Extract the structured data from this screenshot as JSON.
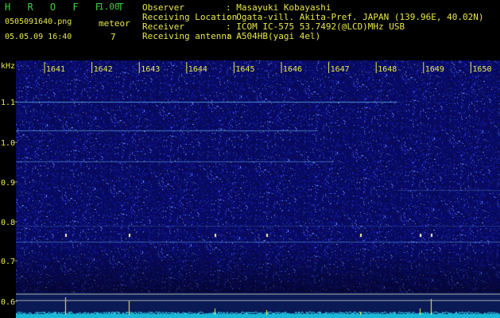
{
  "header": {
    "app_name": "H R O F F T",
    "version": "1.00",
    "filename": "0505091640.png",
    "meteor_label": "meteor",
    "datetime": "05.05.09 16:40",
    "meteor_count": "7",
    "info": [
      {
        "label": "Observer",
        "value": ": Masayuki Kobayashi"
      },
      {
        "label": "Receiving Location",
        "value": ": Ogata-vill. Akita-Pref. JAPAN (139.96E, 40.02N)"
      },
      {
        "label": "Receiver",
        "value": ": ICOM IC-575 53.7492(@LCD)MHz USB"
      },
      {
        "label": "Receiving antenna",
        "value": ": A504HB(yagi 4el)"
      }
    ]
  },
  "spectrogram": {
    "freq_unit": "kHz",
    "freq_ticks": [
      "1.1",
      "1.0",
      "0.9",
      "0.8",
      "0.7",
      "0.6"
    ],
    "time_ticks": [
      "1641",
      "1642",
      "1643",
      "1644",
      "1645",
      "1646",
      "1647",
      "1648",
      "1649",
      "1650"
    ]
  },
  "colors": {
    "background": "#000000",
    "header_text": "#e8e84a",
    "app_name": "#3fd23f",
    "noise_dark": "#0a0a5a",
    "noise_bright": "#6a8cff",
    "signal_line": "#7ad6ff",
    "spike": "#ffff33",
    "power_trace": "#33e0ff"
  }
}
